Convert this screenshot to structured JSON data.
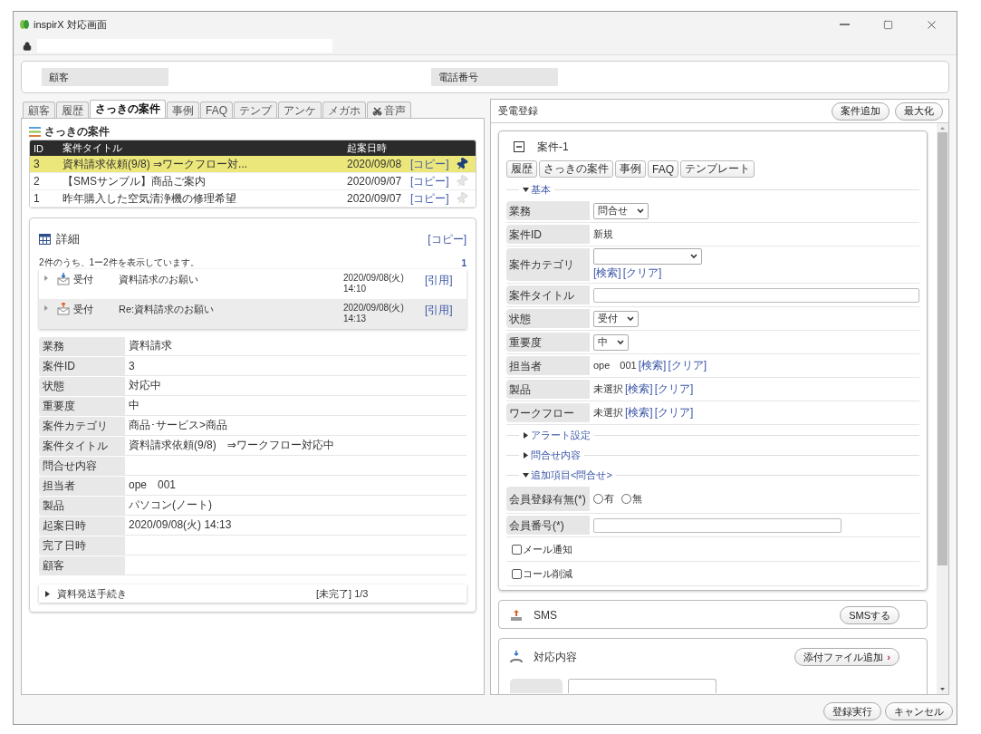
{
  "window": {
    "title": "inspirX 対応画面"
  },
  "customer_header": {
    "fields": [
      {
        "label": "顧客"
      },
      {
        "label": "電話番号"
      }
    ]
  },
  "left_tabs": [
    {
      "label": "顧客",
      "selected": false
    },
    {
      "label": "履歴",
      "selected": false
    },
    {
      "label": "さっきの案件",
      "selected": true
    },
    {
      "label": "事例",
      "selected": false
    },
    {
      "label": "FAQ",
      "selected": false
    },
    {
      "label": "テンプ",
      "selected": false
    },
    {
      "label": "アンケ",
      "selected": false
    },
    {
      "label": "メガホ",
      "selected": false
    },
    {
      "label": "音声",
      "selected": false,
      "kind": "voice"
    }
  ],
  "recent_cases": {
    "title": "さっきの案件",
    "columns": [
      "ID",
      "案件タイトル",
      "起案日時"
    ],
    "rows": [
      {
        "id": "3",
        "title": "資料請求依頼(9/8) ⇒ワークフロー対...",
        "date": "2020/09/08",
        "link": "[コピー]",
        "pinned": true,
        "selected": true
      },
      {
        "id": "2",
        "title": "【SMSサンプル】商品ご案内",
        "date": "2020/09/07",
        "link": "[コピー]",
        "pinned": false,
        "selected": false
      },
      {
        "id": "1",
        "title": "昨年購入した空気清浄機の修理希望",
        "date": "2020/09/07",
        "link": "[コピー]",
        "pinned": false,
        "selected": false
      }
    ]
  },
  "detail": {
    "title": "詳細",
    "copy_link": "[コピー]",
    "summary": "2件のうち、1ー2件を表示しています。",
    "page": "1",
    "history": [
      {
        "kind": "download",
        "type": "受付",
        "subject": "資料請求のお願い",
        "date": "2020/09/08(火)",
        "time": "14:10",
        "link": "[引用]",
        "selected": false
      },
      {
        "kind": "upload",
        "type": "受付",
        "subject": "Re:資料請求のお願い",
        "date": "2020/09/08(火)",
        "time": "14:13",
        "link": "[引用]",
        "selected": true
      }
    ],
    "fields": [
      {
        "label": "業務",
        "value": "資料請求"
      },
      {
        "label": "案件ID",
        "value": "3"
      },
      {
        "label": "状態",
        "value": "対応中"
      },
      {
        "label": "重要度",
        "value": "中"
      },
      {
        "label": "案件カテゴリ",
        "value": "商品･サービス>商品"
      },
      {
        "label": "案件タイトル",
        "value": "資料請求依頼(9/8)　⇒ワークフロー対応中"
      },
      {
        "label": "問合せ内容"
      },
      {
        "label": "担当者",
        "value": "ope　001"
      },
      {
        "label": "製品",
        "value": "パソコン(ノート)"
      },
      {
        "label": "起案日時",
        "value": "2020/09/08(火) 14:13"
      },
      {
        "label": "完了日時"
      },
      {
        "label": "顧客"
      }
    ],
    "workflow": {
      "name": "資料発送手続き",
      "status": "[未完了]",
      "progress": "1/3",
      "expanded": false
    }
  },
  "right_panel": {
    "title": "受電登録",
    "buttons": [
      "案件追加",
      "最大化"
    ]
  },
  "case": {
    "title": "案件-1",
    "expanded": true,
    "tabs": [
      "履歴",
      "さっきの案件",
      "事例",
      "FAQ",
      "テンプレート"
    ],
    "sections": [
      {
        "title": "基本",
        "expanded": true,
        "rows": [
          {
            "kind": "select",
            "label": "業務",
            "value": "問合せ"
          },
          {
            "kind": "text",
            "label": "案件ID",
            "value": "新規"
          },
          {
            "kind": "select_links",
            "label": "案件カテゴリ",
            "links": [
              "[検索]",
              "[クリア]"
            ]
          },
          {
            "kind": "input",
            "label": "案件タイトル"
          },
          {
            "kind": "select",
            "label": "状態",
            "value": "受付"
          },
          {
            "kind": "select",
            "label": "重要度",
            "value": "中"
          },
          {
            "kind": "links",
            "label": "担当者",
            "value": "ope　001",
            "links": [
              "[検索]",
              "[クリア]"
            ]
          },
          {
            "kind": "links",
            "label": "製品",
            "value": "未選択",
            "links": [
              "[検索]",
              "[クリア]"
            ]
          },
          {
            "kind": "links",
            "label": "ワークフロー",
            "value": "未選択",
            "links": [
              "[検索]",
              "[クリア]"
            ]
          }
        ]
      },
      {
        "title": "アラート設定",
        "expanded": false
      },
      {
        "title": "問合せ内容",
        "expanded": false
      },
      {
        "title": "追加項目<問合せ>",
        "expanded": true,
        "rows": [
          {
            "kind": "radio",
            "label": "会員登録有無(*)",
            "options": [
              {
                "label": "有",
                "selected": false
              },
              {
                "label": "無",
                "selected": false
              }
            ]
          },
          {
            "kind": "input",
            "label": "会員番号(*)"
          },
          {
            "kind": "checkbox",
            "label": "メール通知",
            "checked": false
          },
          {
            "kind": "checkbox",
            "label": "コール削減",
            "checked": false
          }
        ]
      }
    ]
  },
  "sms": {
    "title": "SMS",
    "button": "SMSする"
  },
  "response": {
    "title": "対応内容",
    "button": "添付ファイル追加",
    "button_icon": "›"
  },
  "footer_buttons": [
    "登録実行",
    "キャンセル"
  ]
}
